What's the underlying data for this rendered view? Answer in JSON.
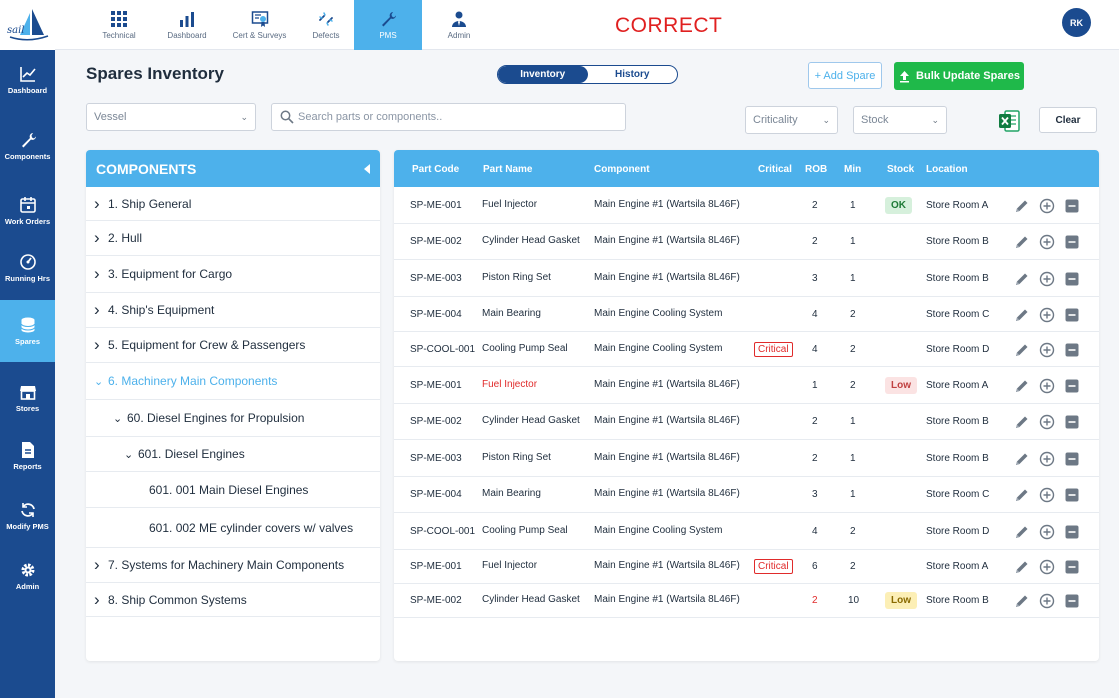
{
  "logo_text": "sail",
  "nav_tabs": [
    {
      "label": "Technical",
      "icon": "grid-icon"
    },
    {
      "label": "Dashboard",
      "icon": "bar-chart-icon"
    },
    {
      "label": "Cert & Surveys",
      "icon": "certificate-icon"
    },
    {
      "label": "Defects",
      "icon": "broken-link-icon"
    },
    {
      "label": "PMS",
      "icon": "wrench-icon",
      "active": true
    },
    {
      "label": "Admin",
      "icon": "user-tie-icon"
    }
  ],
  "banner": "CORRECT",
  "user_initials": "RK",
  "sidebar": [
    {
      "label": "Dashboard",
      "icon": "line-chart-icon"
    },
    {
      "label": "Components",
      "icon": "wrench-icon"
    },
    {
      "label": "Work Orders",
      "icon": "calendar-icon"
    },
    {
      "label": "Running Hrs",
      "icon": "gauge-icon"
    },
    {
      "label": "Spares",
      "icon": "database-icon",
      "active": true
    },
    {
      "label": "Stores",
      "icon": "store-icon"
    },
    {
      "label": "Reports",
      "icon": "report-icon"
    },
    {
      "label": "Modify PMS",
      "icon": "sync-icon"
    },
    {
      "label": "Admin",
      "icon": "gear-icon"
    }
  ],
  "page_title": "Spares Inventory",
  "view_toggle": {
    "inventory": "Inventory",
    "history": "History"
  },
  "buttons": {
    "add_spare": "+ Add Spare",
    "bulk_update": "Bulk Update Spares",
    "clear": "Clear"
  },
  "filters": {
    "vessel": "Vessel",
    "search_placeholder": "Search parts or components..",
    "criticality": "Criticality",
    "stock": "Stock"
  },
  "components_panel": {
    "title": "COMPONENTS",
    "items": [
      {
        "label": "1. Ship General",
        "caret": ">"
      },
      {
        "label": "2. Hull",
        "caret": ">"
      },
      {
        "label": "3. Equipment for Cargo",
        "caret": ">"
      },
      {
        "label": "4. Ship's Equipment",
        "caret": ">"
      },
      {
        "label": "5. Equipment for Crew & Passengers",
        "caret": ">"
      },
      {
        "label": "6. Machinery Main Components",
        "caret": "v",
        "highlight": true
      },
      {
        "label": "60. Diesel Engines for Propulsion",
        "caret": "v"
      },
      {
        "label": "601. Diesel Engines",
        "caret": "v"
      },
      {
        "label": "601. 001 Main Diesel Engines",
        "caret": ""
      },
      {
        "label": "601. 002 ME cylinder covers w/ valves",
        "caret": ""
      },
      {
        "label": "7. Systems for Machinery Main Components",
        "caret": ">"
      },
      {
        "label": "8. Ship Common Systems",
        "caret": ">"
      }
    ]
  },
  "table": {
    "headers": {
      "part_code": "Part Code",
      "part_name": "Part Name",
      "component": "Component",
      "critical": "Critical",
      "rob": "ROB",
      "min": "Min",
      "stock": "Stock",
      "location": "Location"
    },
    "rows": [
      {
        "code": "SP-ME-001",
        "name": "Fuel Injector",
        "component": "Main Engine #1 (Wartsila 8L46F)",
        "critical": "",
        "rob": "2",
        "min": "1",
        "stock": "OK",
        "location": "Store Room A"
      },
      {
        "code": "SP-ME-002",
        "name": "Cylinder Head Gasket",
        "component": "Main Engine #1 (Wartsila 8L46F)",
        "critical": "",
        "rob": "2",
        "min": "1",
        "stock": "",
        "location": "Store Room B"
      },
      {
        "code": "SP-ME-003",
        "name": "Piston Ring Set",
        "component": "Main Engine #1 (Wartsila 8L46F)",
        "critical": "",
        "rob": "3",
        "min": "1",
        "stock": "",
        "location": "Store Room B"
      },
      {
        "code": "SP-ME-004",
        "name": "Main Bearing",
        "component": "Main Engine Cooling System",
        "critical": "",
        "rob": "4",
        "min": "2",
        "stock": "",
        "location": "Store Room C"
      },
      {
        "code": "SP-COOL-001",
        "name": "Cooling Pump Seal",
        "component": "Main Engine Cooling System",
        "critical": "Critical",
        "rob": "4",
        "min": "2",
        "stock": "",
        "location": "Store Room D"
      },
      {
        "code": "SP-ME-001",
        "name": "Fuel Injector",
        "component": "Main Engine #1 (Wartsila 8L46F)",
        "critical": "",
        "rob": "1",
        "min": "2",
        "stock": "Low",
        "location": "Store Room A",
        "name_red": true
      },
      {
        "code": "SP-ME-002",
        "name": "Cylinder Head Gasket",
        "component": "Main Engine #1 (Wartsila 8L46F)",
        "critical": "",
        "rob": "2",
        "min": "1",
        "stock": "",
        "location": "Store Room B"
      },
      {
        "code": "SP-ME-003",
        "name": "Piston Ring Set",
        "component": "Main Engine #1 (Wartsila 8L46F)",
        "critical": "",
        "rob": "2",
        "min": "1",
        "stock": "",
        "location": "Store Room B"
      },
      {
        "code": "SP-ME-004",
        "name": "Main Bearing",
        "component": "Main Engine #1 (Wartsila 8L46F)",
        "critical": "",
        "rob": "3",
        "min": "1",
        "stock": "",
        "location": "Store Room C"
      },
      {
        "code": "SP-COOL-001",
        "name": "Cooling Pump Seal",
        "component": "Main Engine Cooling System",
        "critical": "",
        "rob": "4",
        "min": "2",
        "stock": "",
        "location": "Store Room D"
      },
      {
        "code": "SP-ME-001",
        "name": "Fuel Injector",
        "component": "Main Engine #1 (Wartsila 8L46F)",
        "critical": "Critical",
        "rob": "6",
        "min": "2",
        "stock": "",
        "location": "Store Room A"
      },
      {
        "code": "SP-ME-002",
        "name": "Cylinder Head Gasket",
        "component": "Main Engine #1 (Wartsila 8L46F)",
        "critical": "",
        "rob": "2",
        "min": "10",
        "stock": "Low",
        "location": "Store Room B",
        "rob_red": true,
        "low_yellow": true
      }
    ]
  },
  "colors": {
    "primary": "#1b4b8f",
    "accent": "#4db1eb",
    "success": "#1fb94a",
    "danger": "#e02b2b"
  }
}
